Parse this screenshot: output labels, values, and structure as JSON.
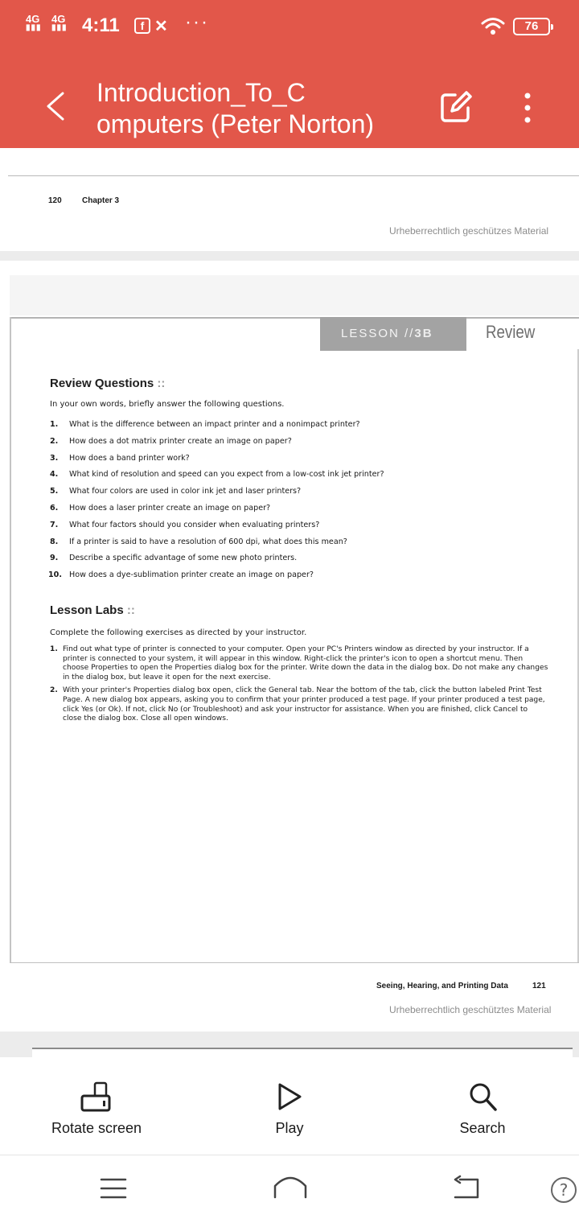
{
  "status_bar": {
    "signal_1": "4G",
    "signal_2": "4G",
    "time": "4:11",
    "facebook_glyph": "f",
    "missed_call_glyph": "✕",
    "more_glyph": "···",
    "battery": "76",
    "icons": [
      "signal-icon",
      "facebook-icon",
      "missed-call-icon",
      "wifi-icon",
      "battery-icon"
    ]
  },
  "header": {
    "title_line1": "Introduction_To_C",
    "title_line2": "omputers (Peter Norton)",
    "background_color": "#e2574a"
  },
  "page_top": {
    "page_number": "120",
    "chapter": "Chapter 3",
    "copyright": "Urheberrechtlich geschützes Material"
  },
  "page_main": {
    "lesson_prefix": "LESSON //",
    "lesson_number": "3B",
    "lesson_label": "Review",
    "review_questions": {
      "heading": "Review Questions",
      "suffix": "::",
      "intro": "In your own words, briefly answer the following questions.",
      "items": [
        {
          "n": "1.",
          "text": "What is the difference between an impact printer and a nonimpact printer?"
        },
        {
          "n": "2.",
          "text": "How does a dot matrix printer create an image on paper?"
        },
        {
          "n": "3.",
          "text": "How does a band printer work?"
        },
        {
          "n": "4.",
          "text": "What kind of resolution and speed can you expect from a low-cost ink jet printer?"
        },
        {
          "n": "5.",
          "text": "What four colors are used in color ink jet and laser printers?"
        },
        {
          "n": "6.",
          "text": "How does a laser printer create an image on paper?"
        },
        {
          "n": "7.",
          "text": "What four factors should you consider when evaluating printers?"
        },
        {
          "n": "8.",
          "text": "If a printer is said to have a resolution of 600 dpi, what does this mean?"
        },
        {
          "n": "9.",
          "text": "Describe a specific advantage of some new photo printers."
        },
        {
          "n": "10.",
          "text": "How does a dye-sublimation printer create an image on paper?"
        }
      ]
    },
    "lesson_labs": {
      "heading": "Lesson Labs",
      "suffix": "::",
      "intro": "Complete the following exercises as directed by your instructor.",
      "items": [
        {
          "n": "1.",
          "text": "Find out what type of printer is connected to your computer. Open your PC's Printers window as directed by your instructor. If a printer is connected to your system, it will appear in this window. Right-click the printer's icon to open a shortcut menu. Then choose Properties to open the Properties dialog box for the printer. Write down the data in the dialog box. Do not make any changes in the dialog box, but leave it open for the next exercise."
        },
        {
          "n": "2.",
          "text": "With your printer's Properties dialog box open, click the General tab. Near the bottom of the tab, click the button labeled Print Test Page. A new dialog box appears, asking you to confirm that your printer produced a test page. If your printer produced a test page, click Yes (or Ok). If not, click No (or Troubleshoot) and ask your instructor for assistance. When you are finished, click Cancel to close the dialog box. Close all open windows."
        }
      ]
    },
    "footer_running_head": "Seeing, Hearing, and Printing Data",
    "footer_page_number": "121",
    "copyright": "Urheberrechtlich geschütztes Material"
  },
  "toolbar": {
    "rotate_label": "Rotate screen",
    "play_label": "Play",
    "search_label": "Search"
  },
  "navbar": {
    "help_glyph": "?"
  }
}
